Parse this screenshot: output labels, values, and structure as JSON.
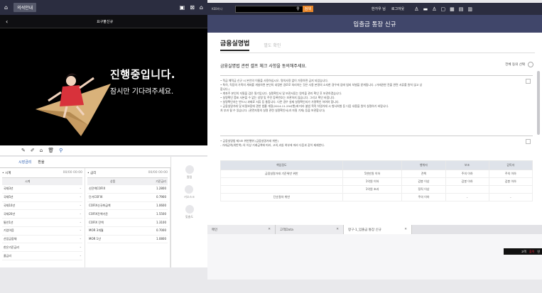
{
  "left": {
    "top_bar": {
      "badge": "의석안내"
    },
    "sub_bar": {
      "title": "요구불신규"
    },
    "promo": {
      "headline": "진행중입니다.",
      "subline": "잠시만 기다려주세요."
    },
    "list_tabs": [
      "시장금리",
      "환율"
    ],
    "list_left": {
      "title": "• 시계",
      "date": "00/00 00:00",
      "header": [
        "시계",
        ""
      ],
      "rows": [
        [
          "국채3년",
          "-"
        ],
        [
          "국채5년",
          "-"
        ],
        [
          "국채10년",
          "-"
        ],
        [
          "국채20년",
          "-"
        ],
        [
          "통안1년",
          "-"
        ],
        [
          "기업어음",
          "-"
        ],
        [
          "산업금융채",
          "-"
        ],
        [
          "한은기준금리",
          "-"
        ],
        [
          "콜금리",
          "-"
        ]
      ]
    },
    "list_right": {
      "title": "• 금리",
      "date": "00/00 00:00",
      "header": [
        "상품",
        "기준금리"
      ],
      "rows": [
        [
          "신잔액COFIX",
          "1.2800"
        ],
        [
          "단기COFIX",
          "0.7900"
        ],
        [
          "COFIX신규취급액",
          "1.0600"
        ],
        [
          "COFIX잔액기준",
          "1.5500"
        ],
        [
          "COFIX 잔액",
          "1.3100"
        ],
        [
          "MOR 3개월",
          "0.7000"
        ],
        [
          "MOR 1년",
          "1.0800"
        ]
      ]
    },
    "side_buttons": [
      "알림",
      "키오스크",
      "맞춤도"
    ]
  },
  "right": {
    "top_bar": {
      "logo": "KEB하나",
      "go_label": "검색",
      "user": "한가우 님",
      "logout": "로그아웃"
    },
    "title": "입출금 통장 신규",
    "tabs": [
      "금융실명법",
      "별도 확인"
    ],
    "instruction": "금융실명법 관련 셀프 체크 사항을 동의해주세요.",
    "agree_all": "전체 동의 선택",
    "agree_box_1": [
      "• 적금 예적금 신규 시 본인의 이름을 사용하십시오. 명의사용 없이 가용하면 금지 되었습니다.",
      "• 특히, 직장의 가족의 계좌를 개설하면 본인의 내정한 경로로 처리하는 것은 사용 본명의 소지한 경우에 업에 범죄 처벌을 받게됩니다. (거래권한 전출 관련 서류를 원칙 않고 상",
      "  합니다.)",
      "",
      "• 계좌주 본인의 자필을 검은 필기입니다. 실명확인서 및 보관서류는 원칙을 관리 확인 후 보관하겠습니다.",
      "• 실명확인 증표 사본을 수 없는 성명 및 주민 등록번호는 보관하지 않습니다. 그리고 확인 바랍니다.",
      "• 실명확인자는 반드시 과태료 서류 등 통합니다. 다른 경우 실제 실명확인지가 가명확인 하여야 합니다.",
      "• 금융실명거래 및 비밀보장에 관한 법률 개정(2014.11.29시행)에 따라 불법 목적 차명거래 시 형사처벌 등 다음 내용을 원칙 실명하기 바랍니다.",
      "  처 부과 될 수 있습니다. (관련자명의 실명 관련 실명확인서(과 자필 기재) 등을 보관합니다)"
    ],
    "agree_box_2": [
      "• 금융실명법 제3조 위반행위 (금융실명거래 위반)",
      "  - 거래금액(위반액) 의 이상 거래금액에 따라, 고의,과실 여부에 따라 다음과 같이 제재한다."
    ],
    "risk_table": {
      "headers": [
        "책임정도",
        "",
        "행위자",
        "보조",
        "감독자"
      ],
      "rows": [
        [
          "금융실명거래 기준위반 위반",
          "5천만원 이하",
          "견책",
          "주의 이하",
          "주의 이하"
        ],
        [
          "",
          "1억원 이하",
          "감봉 이상",
          "감봉 이하",
          "감봉 이하"
        ],
        [
          "",
          "1억원 초과",
          "정직 이상",
          "",
          ""
        ],
        [
          "단순절차 위반",
          "",
          "주의 이하",
          "-",
          "-"
        ]
      ]
    },
    "bottom_tabs": [
      "메인",
      "고객Data",
      "항구-1_입출금 통장 신규"
    ],
    "corner": [
      "고객",
      "출력",
      "인"
    ]
  },
  "colors": {
    "dark_bar": "#2b2d40",
    "title_bar": "#40466a",
    "accent": "#e8862a"
  }
}
